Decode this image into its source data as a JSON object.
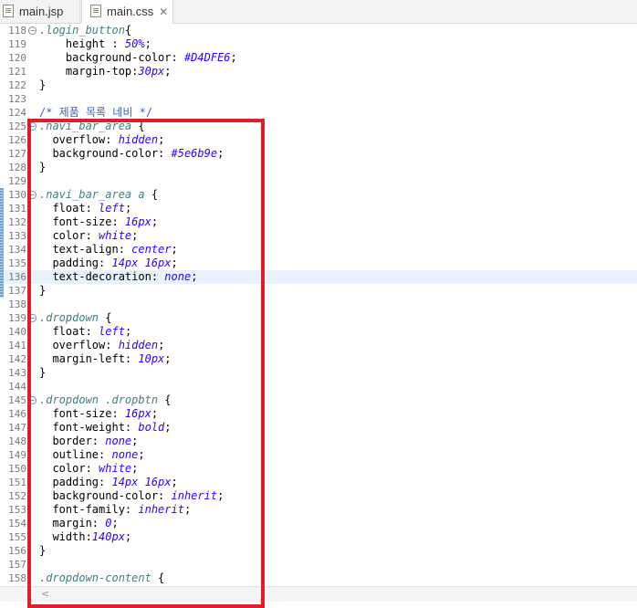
{
  "tabs": [
    {
      "label": "main.jsp",
      "icon": "jsp-file-icon",
      "active": false
    },
    {
      "label": "main.css",
      "icon": "css-file-icon",
      "active": true,
      "close": "✕"
    }
  ],
  "colors": {
    "highlight_box": "#e21c2a",
    "current_line": "#e8f2fe"
  },
  "lines": [
    {
      "n": "118",
      "fold": true,
      "t": [
        [
          "sel",
          ".login_button"
        ],
        [
          "pn",
          "{"
        ]
      ]
    },
    {
      "n": "119",
      "t": [
        [
          "prop",
          "    height : "
        ],
        [
          "val",
          "50%"
        ],
        [
          "pn",
          ";"
        ]
      ]
    },
    {
      "n": "120",
      "t": [
        [
          "prop",
          "    background-color: "
        ],
        [
          "val",
          "#D4DFE6"
        ],
        [
          "pn",
          ";"
        ]
      ]
    },
    {
      "n": "121",
      "t": [
        [
          "prop",
          "    margin-top:"
        ],
        [
          "val",
          "30px"
        ],
        [
          "pn",
          ";"
        ]
      ]
    },
    {
      "n": "122",
      "t": [
        [
          "pn",
          "}"
        ]
      ]
    },
    {
      "n": "123",
      "t": []
    },
    {
      "n": "124",
      "t": [
        [
          "cmt",
          "/* 제품 목록 네비 */"
        ]
      ]
    },
    {
      "n": "125",
      "fold": true,
      "t": [
        [
          "sel",
          ".navi_bar_area"
        ],
        [
          "pn",
          " {"
        ]
      ]
    },
    {
      "n": "126",
      "t": [
        [
          "prop",
          "  overflow: "
        ],
        [
          "val",
          "hidden"
        ],
        [
          "pn",
          ";"
        ]
      ]
    },
    {
      "n": "127",
      "t": [
        [
          "prop",
          "  background-color: "
        ],
        [
          "val",
          "#5e6b9e"
        ],
        [
          "pn",
          ";"
        ]
      ]
    },
    {
      "n": "128",
      "t": [
        [
          "pn",
          "}"
        ]
      ]
    },
    {
      "n": "129",
      "t": []
    },
    {
      "n": "130",
      "fold": true,
      "t": [
        [
          "sel",
          ".navi_bar_area a"
        ],
        [
          "pn",
          " {"
        ]
      ]
    },
    {
      "n": "131",
      "t": [
        [
          "prop",
          "  float: "
        ],
        [
          "val",
          "left"
        ],
        [
          "pn",
          ";"
        ]
      ]
    },
    {
      "n": "132",
      "t": [
        [
          "prop",
          "  font-size: "
        ],
        [
          "val",
          "16px"
        ],
        [
          "pn",
          ";"
        ]
      ]
    },
    {
      "n": "133",
      "t": [
        [
          "prop",
          "  color: "
        ],
        [
          "val",
          "white"
        ],
        [
          "pn",
          ";"
        ]
      ]
    },
    {
      "n": "134",
      "t": [
        [
          "prop",
          "  text-align: "
        ],
        [
          "val",
          "center"
        ],
        [
          "pn",
          ";"
        ]
      ]
    },
    {
      "n": "135",
      "t": [
        [
          "prop",
          "  padding: "
        ],
        [
          "val",
          "14px 16px"
        ],
        [
          "pn",
          ";"
        ]
      ]
    },
    {
      "n": "136",
      "hl": true,
      "t": [
        [
          "prop",
          "  text-decoration: "
        ],
        [
          "val",
          "none"
        ],
        [
          "pn",
          ";"
        ]
      ]
    },
    {
      "n": "137",
      "t": [
        [
          "pn",
          "}"
        ]
      ]
    },
    {
      "n": "138",
      "t": []
    },
    {
      "n": "139",
      "fold": true,
      "t": [
        [
          "sel",
          ".dropdown"
        ],
        [
          "pn",
          " {"
        ]
      ]
    },
    {
      "n": "140",
      "t": [
        [
          "prop",
          "  float: "
        ],
        [
          "val",
          "left"
        ],
        [
          "pn",
          ";"
        ]
      ]
    },
    {
      "n": "141",
      "t": [
        [
          "prop",
          "  overflow: "
        ],
        [
          "val",
          "hidden"
        ],
        [
          "pn",
          ";"
        ]
      ]
    },
    {
      "n": "142",
      "t": [
        [
          "prop",
          "  margin-left: "
        ],
        [
          "val",
          "10px"
        ],
        [
          "pn",
          ";"
        ]
      ]
    },
    {
      "n": "143",
      "t": [
        [
          "pn",
          "}"
        ]
      ]
    },
    {
      "n": "144",
      "t": []
    },
    {
      "n": "145",
      "fold": true,
      "t": [
        [
          "sel",
          ".dropdown .dropbtn"
        ],
        [
          "pn",
          " {"
        ]
      ]
    },
    {
      "n": "146",
      "t": [
        [
          "prop",
          "  font-size: "
        ],
        [
          "val",
          "16px"
        ],
        [
          "pn",
          ";"
        ]
      ]
    },
    {
      "n": "147",
      "t": [
        [
          "prop",
          "  font-weight: "
        ],
        [
          "val",
          "bold"
        ],
        [
          "pn",
          ";"
        ]
      ]
    },
    {
      "n": "148",
      "t": [
        [
          "prop",
          "  border: "
        ],
        [
          "val",
          "none"
        ],
        [
          "pn",
          ";"
        ]
      ]
    },
    {
      "n": "149",
      "t": [
        [
          "prop",
          "  outline: "
        ],
        [
          "val",
          "none"
        ],
        [
          "pn",
          ";"
        ]
      ]
    },
    {
      "n": "150",
      "t": [
        [
          "prop",
          "  color: "
        ],
        [
          "val",
          "white"
        ],
        [
          "pn",
          ";"
        ]
      ]
    },
    {
      "n": "151",
      "t": [
        [
          "prop",
          "  padding: "
        ],
        [
          "val",
          "14px 16px"
        ],
        [
          "pn",
          ";"
        ]
      ]
    },
    {
      "n": "152",
      "t": [
        [
          "prop",
          "  background-color: "
        ],
        [
          "val",
          "inherit"
        ],
        [
          "pn",
          ";"
        ]
      ]
    },
    {
      "n": "153",
      "t": [
        [
          "prop",
          "  font-family: "
        ],
        [
          "val",
          "inherit"
        ],
        [
          "pn",
          ";"
        ]
      ]
    },
    {
      "n": "154",
      "t": [
        [
          "prop",
          "  margin: "
        ],
        [
          "val",
          "0"
        ],
        [
          "pn",
          ";"
        ]
      ]
    },
    {
      "n": "155",
      "t": [
        [
          "prop",
          "  width:"
        ],
        [
          "val",
          "140px"
        ],
        [
          "pn",
          ";"
        ]
      ]
    },
    {
      "n": "156",
      "t": [
        [
          "pn",
          "}"
        ]
      ]
    },
    {
      "n": "157",
      "t": []
    },
    {
      "n": "158",
      "t": [
        [
          "sel",
          ".dropdown-content"
        ],
        [
          "pn",
          " {"
        ]
      ]
    }
  ],
  "scroll_left_arrow": "<"
}
